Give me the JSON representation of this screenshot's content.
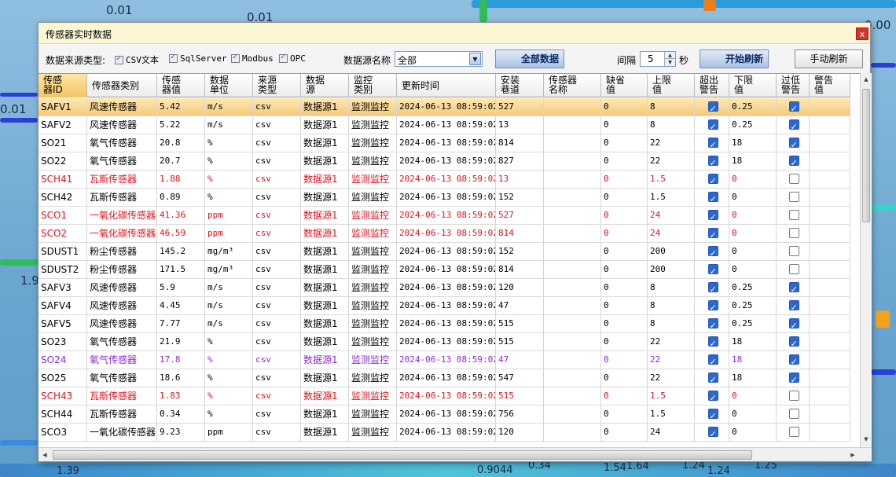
{
  "background": {
    "labels": [
      "0.01",
      "0.01",
      "0.00",
      "0.01",
      "1.9",
      "1.39",
      "0.9044",
      "0.34",
      "1.54",
      "1.64",
      "1.24",
      "1.24",
      "1.25"
    ]
  },
  "window": {
    "title": "传感器实时数据",
    "close_glyph": "x"
  },
  "toolbar": {
    "source_type_label": "数据来源类型:",
    "source_types": [
      {
        "label": "CSV文本",
        "checked": true
      },
      {
        "label": "SqlServer",
        "checked": true
      },
      {
        "label": "Modbus",
        "checked": true
      },
      {
        "label": "OPC",
        "checked": true
      }
    ],
    "source_name_label": "数据源名称",
    "source_name_value": "全部",
    "all_data_button": "全部数据",
    "interval_label": "间隔",
    "interval_value": "5",
    "interval_unit": "秒",
    "start_refresh_button": "开始刷新",
    "manual_refresh_button": "手动刷新"
  },
  "colors": {
    "alarm_red": "#e0141e",
    "purple": "#8a2bd6",
    "normal": "#000000",
    "selected_row": "#f6c978"
  },
  "grid": {
    "columns": [
      "传感\n器ID",
      "传感器类别",
      "传感\n器值",
      "数据\n单位",
      "来源\n类型",
      "数据\n源",
      "监控\n类别",
      "更新时间",
      "安装\n巷道",
      "传感器\n名称",
      "缺省\n值",
      "上限\n值",
      "超出\n警告",
      "下限\n值",
      "过低\n警告",
      "警告\n值"
    ],
    "rows": [
      {
        "id": "SAFV1",
        "type": "风速传感器",
        "value": "5.42",
        "unit": "m/s",
        "src": "csv",
        "ds": "数据源1",
        "mon": "监测监控",
        "time": "2024-06-13 08:59:02",
        "lane": "527",
        "name": "",
        "def": "0",
        "up": "8",
        "over": true,
        "low": "0.25",
        "under": true,
        "warn": "",
        "style": "selected"
      },
      {
        "id": "SAFV2",
        "type": "风速传感器",
        "value": "5.22",
        "unit": "m/s",
        "src": "csv",
        "ds": "数据源1",
        "mon": "监测监控",
        "time": "2024-06-13 08:59:02",
        "lane": "13",
        "name": "",
        "def": "0",
        "up": "8",
        "over": true,
        "low": "0.25",
        "under": true,
        "warn": "",
        "style": "normal"
      },
      {
        "id": "SO21",
        "type": "氧气传感器",
        "value": "20.8",
        "unit": "%",
        "src": "csv",
        "ds": "数据源1",
        "mon": "监测监控",
        "time": "2024-06-13 08:59:02",
        "lane": "814",
        "name": "",
        "def": "0",
        "up": "22",
        "over": true,
        "low": "18",
        "under": true,
        "warn": "",
        "style": "normal"
      },
      {
        "id": "SO22",
        "type": "氧气传感器",
        "value": "20.7",
        "unit": "%",
        "src": "csv",
        "ds": "数据源1",
        "mon": "监测监控",
        "time": "2024-06-13 08:59:02",
        "lane": "827",
        "name": "",
        "def": "0",
        "up": "22",
        "over": true,
        "low": "18",
        "under": true,
        "warn": "",
        "style": "normal"
      },
      {
        "id": "SCH41",
        "type": "瓦斯传感器",
        "value": "1.88",
        "unit": "%",
        "src": "csv",
        "ds": "数据源1",
        "mon": "监测监控",
        "time": "2024-06-13 08:59:02",
        "lane": "13",
        "name": "",
        "def": "0",
        "up": "1.5",
        "over": true,
        "low": "0",
        "under": false,
        "warn": "",
        "style": "alarm"
      },
      {
        "id": "SCH42",
        "type": "瓦斯传感器",
        "value": "0.89",
        "unit": "%",
        "src": "csv",
        "ds": "数据源1",
        "mon": "监测监控",
        "time": "2024-06-13 08:59:02",
        "lane": "152",
        "name": "",
        "def": "0",
        "up": "1.5",
        "over": true,
        "low": "0",
        "under": false,
        "warn": "",
        "style": "normal"
      },
      {
        "id": "SCO1",
        "type": "一氧化碳传感器",
        "value": "41.36",
        "unit": "ppm",
        "src": "csv",
        "ds": "数据源1",
        "mon": "监测监控",
        "time": "2024-06-13 08:59:02",
        "lane": "527",
        "name": "",
        "def": "0",
        "up": "24",
        "over": true,
        "low": "0",
        "under": false,
        "warn": "",
        "style": "alarm"
      },
      {
        "id": "SCO2",
        "type": "一氧化碳传感器",
        "value": "46.59",
        "unit": "ppm",
        "src": "csv",
        "ds": "数据源1",
        "mon": "监测监控",
        "time": "2024-06-13 08:59:02",
        "lane": "814",
        "name": "",
        "def": "0",
        "up": "24",
        "over": true,
        "low": "0",
        "under": false,
        "warn": "",
        "style": "alarm"
      },
      {
        "id": "SDUST1",
        "type": "粉尘传感器",
        "value": "145.2",
        "unit": "mg/m³",
        "src": "csv",
        "ds": "数据源1",
        "mon": "监测监控",
        "time": "2024-06-13 08:59:02",
        "lane": "152",
        "name": "",
        "def": "0",
        "up": "200",
        "over": true,
        "low": "0",
        "under": false,
        "warn": "",
        "style": "normal"
      },
      {
        "id": "SDUST2",
        "type": "粉尘传感器",
        "value": "171.5",
        "unit": "mg/m³",
        "src": "csv",
        "ds": "数据源1",
        "mon": "监测监控",
        "time": "2024-06-13 08:59:02",
        "lane": "814",
        "name": "",
        "def": "0",
        "up": "200",
        "over": true,
        "low": "0",
        "under": false,
        "warn": "",
        "style": "normal"
      },
      {
        "id": "SAFV3",
        "type": "风速传感器",
        "value": "5.9",
        "unit": "m/s",
        "src": "csv",
        "ds": "数据源1",
        "mon": "监测监控",
        "time": "2024-06-13 08:59:02",
        "lane": "120",
        "name": "",
        "def": "0",
        "up": "8",
        "over": true,
        "low": "0.25",
        "under": true,
        "warn": "",
        "style": "normal"
      },
      {
        "id": "SAFV4",
        "type": "风速传感器",
        "value": "4.45",
        "unit": "m/s",
        "src": "csv",
        "ds": "数据源1",
        "mon": "监测监控",
        "time": "2024-06-13 08:59:02",
        "lane": "47",
        "name": "",
        "def": "0",
        "up": "8",
        "over": true,
        "low": "0.25",
        "under": true,
        "warn": "",
        "style": "normal"
      },
      {
        "id": "SAFV5",
        "type": "风速传感器",
        "value": "7.77",
        "unit": "m/s",
        "src": "csv",
        "ds": "数据源1",
        "mon": "监测监控",
        "time": "2024-06-13 08:59:02",
        "lane": "515",
        "name": "",
        "def": "0",
        "up": "8",
        "over": true,
        "low": "0.25",
        "under": true,
        "warn": "",
        "style": "normal"
      },
      {
        "id": "SO23",
        "type": "氧气传感器",
        "value": "21.9",
        "unit": "%",
        "src": "csv",
        "ds": "数据源1",
        "mon": "监测监控",
        "time": "2024-06-13 08:59:02",
        "lane": "515",
        "name": "",
        "def": "0",
        "up": "22",
        "over": true,
        "low": "18",
        "under": true,
        "warn": "",
        "style": "normal"
      },
      {
        "id": "SO24",
        "type": "氧气传感器",
        "value": "17.8",
        "unit": "%",
        "src": "csv",
        "ds": "数据源1",
        "mon": "监测监控",
        "time": "2024-06-13 08:59:02",
        "lane": "47",
        "name": "",
        "def": "0",
        "up": "22",
        "over": true,
        "low": "18",
        "under": true,
        "warn": "",
        "style": "low"
      },
      {
        "id": "SO25",
        "type": "氧气传感器",
        "value": "18.6",
        "unit": "%",
        "src": "csv",
        "ds": "数据源1",
        "mon": "监测监控",
        "time": "2024-06-13 08:59:02",
        "lane": "547",
        "name": "",
        "def": "0",
        "up": "22",
        "over": true,
        "low": "18",
        "under": true,
        "warn": "",
        "style": "normal"
      },
      {
        "id": "SCH43",
        "type": "瓦斯传感器",
        "value": "1.83",
        "unit": "%",
        "src": "csv",
        "ds": "数据源1",
        "mon": "监测监控",
        "time": "2024-06-13 08:59:02",
        "lane": "515",
        "name": "",
        "def": "0",
        "up": "1.5",
        "over": true,
        "low": "0",
        "under": false,
        "warn": "",
        "style": "alarm"
      },
      {
        "id": "SCH44",
        "type": "瓦斯传感器",
        "value": "0.34",
        "unit": "%",
        "src": "csv",
        "ds": "数据源1",
        "mon": "监测监控",
        "time": "2024-06-13 08:59:02",
        "lane": "756",
        "name": "",
        "def": "0",
        "up": "1.5",
        "over": true,
        "low": "0",
        "under": false,
        "warn": "",
        "style": "normal"
      },
      {
        "id": "SCO3",
        "type": "一氧化碳传感器",
        "value": "9.23",
        "unit": "ppm",
        "src": "csv",
        "ds": "数据源1",
        "mon": "监测监控",
        "time": "2024-06-13 08:59:02",
        "lane": "120",
        "name": "",
        "def": "0",
        "up": "24",
        "over": true,
        "low": "0",
        "under": false,
        "warn": "",
        "style": "normal"
      }
    ]
  }
}
